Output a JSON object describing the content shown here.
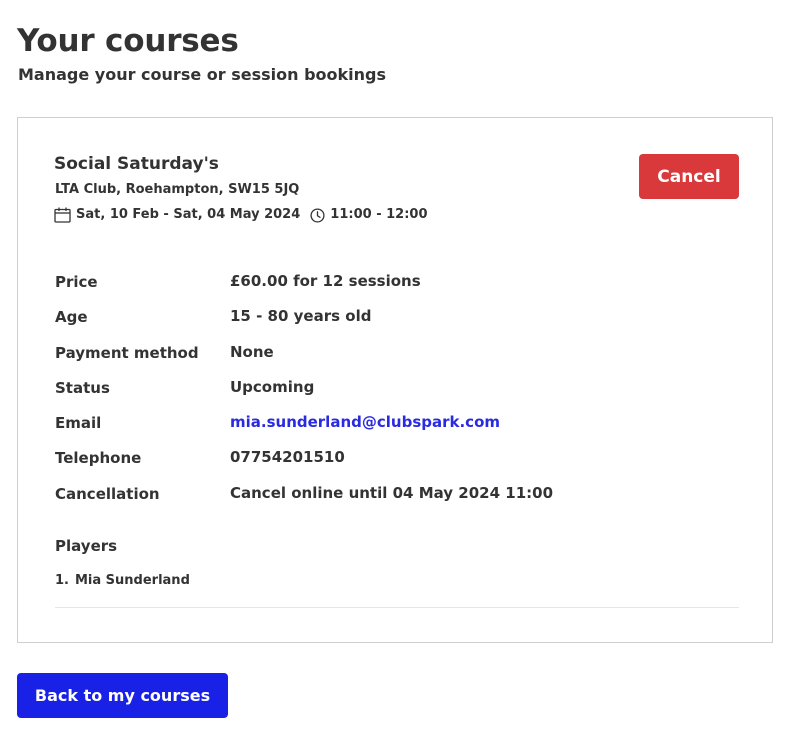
{
  "page": {
    "title": "Your courses",
    "subtitle": "Manage your course or session bookings"
  },
  "course": {
    "name": "Social Saturday's",
    "venue": "LTA Club, Roehampton, SW15 5JQ",
    "dates": "Sat, 10 Feb - Sat, 04 May 2024",
    "times": "11:00 - 12:00",
    "date_icon": "calendar-icon",
    "time_icon": "clock-icon",
    "cancel_label": "Cancel"
  },
  "details": [
    {
      "label": "Price",
      "value": "£60.00 for 12 sessions"
    },
    {
      "label": "Age",
      "value": "15 - 80 years old"
    },
    {
      "label": "Payment method",
      "value": "None"
    },
    {
      "label": "Status",
      "value": "Upcoming"
    },
    {
      "label": "Email",
      "value": "mia.sunderland@clubspark.com"
    },
    {
      "label": "Telephone",
      "value": "07754201510"
    },
    {
      "label": "Cancellation",
      "value": "Cancel online until 04 May 2024 11:00"
    }
  ],
  "players": {
    "heading": "Players",
    "items": [
      {
        "number": "1.",
        "name": "Mia Sunderland"
      }
    ]
  },
  "footer": {
    "back_label": "Back to my courses"
  },
  "colors": {
    "cancel_button": "#d9393a",
    "back_button": "#1a21e6",
    "link": "#2a2be0",
    "text": "#333333"
  }
}
